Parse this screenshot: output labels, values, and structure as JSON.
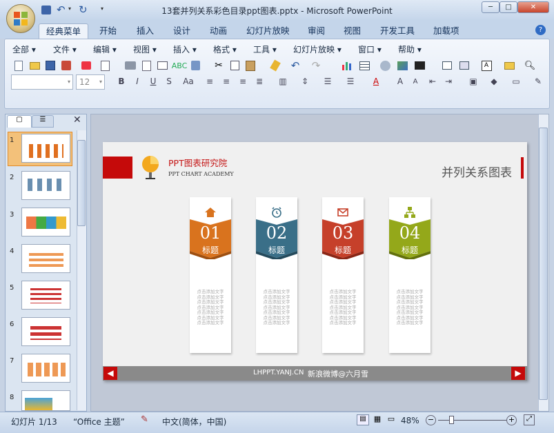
{
  "window": {
    "title": "13套并列关系彩色目录ppt图表.pptx - Microsoft PowerPoint"
  },
  "ribbon_tabs": [
    "经典菜单",
    "开始",
    "插入",
    "设计",
    "动画",
    "幻灯片放映",
    "审阅",
    "视图",
    "开发工具",
    "加载项"
  ],
  "classic_menu": [
    "全部",
    "文件",
    "编辑",
    "视图",
    "插入",
    "格式",
    "工具",
    "幻灯片放映",
    "窗口",
    "帮助"
  ],
  "font_size": "12",
  "slide_panel": {
    "numbers": [
      "1",
      "2",
      "3",
      "4",
      "5",
      "6",
      "7",
      "8"
    ]
  },
  "slide": {
    "brand_title": "PPT图表研究院",
    "brand_sub": "PPT CHART ACADEMY",
    "heading": "并列关系图表",
    "footer_url": "LHPPT.YANJ.CN",
    "footer_weibo": "新浪微博@六月雪",
    "cards": [
      {
        "num": "01",
        "label": "标题",
        "color": "#d9731e",
        "dark": "#9e4f10",
        "icon": "home-icon",
        "text": "点击添加文字\n点击添加文字\n点击添加文字\n点击添加文字\n点击添加文字\n点击添加文字\n点击添加文字"
      },
      {
        "num": "02",
        "label": "标题",
        "color": "#3a6f88",
        "dark": "#244a5c",
        "icon": "alarm-clock-icon",
        "text": "点击添加文字\n点击添加文字\n点击添加文字\n点击添加文字\n点击添加文字\n点击添加文字\n点击添加文字"
      },
      {
        "num": "03",
        "label": "标题",
        "color": "#c6402a",
        "dark": "#8a2616",
        "icon": "mail-icon",
        "text": "点击添加文字\n点击添加文字\n点击添加文字\n点击添加文字\n点击添加文字\n点击添加文字\n点击添加文字"
      },
      {
        "num": "04",
        "label": "标题",
        "color": "#94a81a",
        "dark": "#62700c",
        "icon": "org-chart-icon",
        "text": "点击添加文字\n点击添加文字\n点击添加文字\n点击添加文字\n点击添加文字\n点击添加文字\n点击添加文字"
      }
    ]
  },
  "status": {
    "slide_info": "幻灯片 1/13",
    "theme": "“Office 主题”",
    "language": "中文(简体，中国)",
    "zoom": "48%"
  }
}
